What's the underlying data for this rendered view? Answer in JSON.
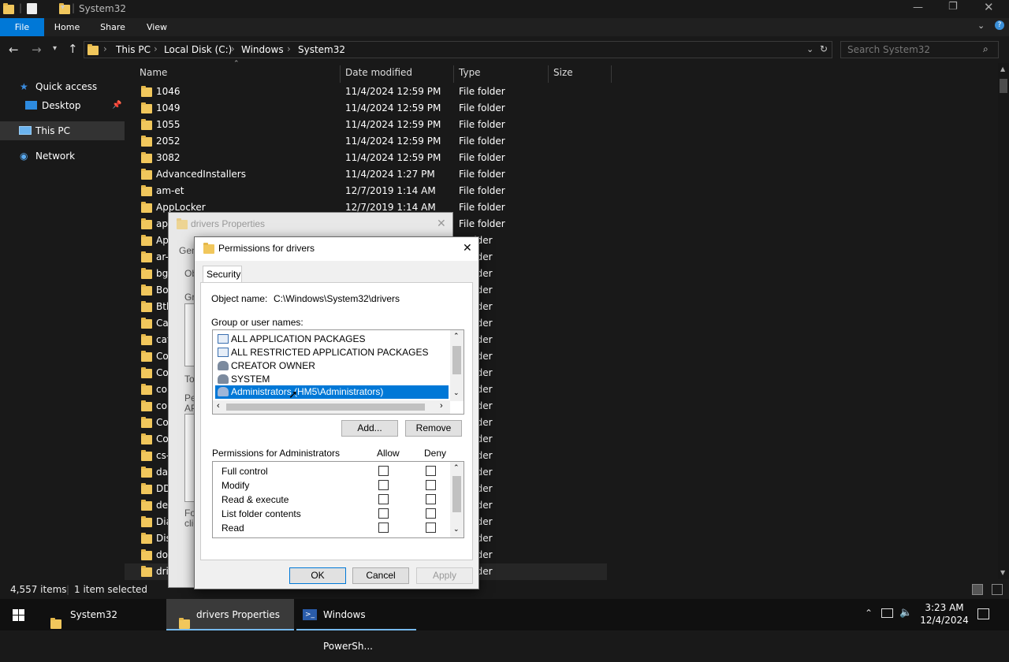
{
  "window": {
    "title": "System32"
  },
  "ribbon": {
    "tabs": [
      "File",
      "Home",
      "Share",
      "View"
    ]
  },
  "address": {
    "crumbs": [
      "This PC",
      "Local Disk (C:)",
      "Windows",
      "System32"
    ],
    "search_placeholder": "Search System32"
  },
  "sidebar": {
    "items": [
      {
        "label": "Quick access",
        "icon": "star-icon"
      },
      {
        "label": "Desktop",
        "icon": "desktop-icon"
      },
      {
        "label": "This PC",
        "icon": "pc-icon"
      },
      {
        "label": "Network",
        "icon": "network-icon"
      }
    ]
  },
  "columns": {
    "name": "Name",
    "date": "Date modified",
    "type": "Type",
    "size": "Size"
  },
  "files": [
    {
      "name": "1046",
      "date": "11/4/2024 12:59 PM",
      "type": "File folder"
    },
    {
      "name": "1049",
      "date": "11/4/2024 12:59 PM",
      "type": "File folder"
    },
    {
      "name": "1055",
      "date": "11/4/2024 12:59 PM",
      "type": "File folder"
    },
    {
      "name": "2052",
      "date": "11/4/2024 12:59 PM",
      "type": "File folder"
    },
    {
      "name": "3082",
      "date": "11/4/2024 12:59 PM",
      "type": "File folder"
    },
    {
      "name": "AdvancedInstallers",
      "date": "11/4/2024 1:27 PM",
      "type": "File folder"
    },
    {
      "name": "am-et",
      "date": "12/7/2019 1:14 AM",
      "type": "File folder"
    },
    {
      "name": "AppLocker",
      "date": "12/7/2019 1:14 AM",
      "type": "File folder"
    },
    {
      "name": "ap",
      "date": "",
      "type": "File folder"
    },
    {
      "name": "Ap",
      "date": "",
      "type": "older"
    },
    {
      "name": "ar-",
      "date": "",
      "type": "older"
    },
    {
      "name": "bg",
      "date": "",
      "type": "older"
    },
    {
      "name": "Bo",
      "date": "",
      "type": "older"
    },
    {
      "name": "Bth",
      "date": "",
      "type": "older"
    },
    {
      "name": "Ca",
      "date": "",
      "type": "older"
    },
    {
      "name": "cat",
      "date": "",
      "type": "older"
    },
    {
      "name": "Co",
      "date": "",
      "type": "older"
    },
    {
      "name": "Co",
      "date": "",
      "type": "older"
    },
    {
      "name": "co",
      "date": "",
      "type": "older"
    },
    {
      "name": "co",
      "date": "",
      "type": "older"
    },
    {
      "name": "Co",
      "date": "",
      "type": "older"
    },
    {
      "name": "Co",
      "date": "",
      "type": "older"
    },
    {
      "name": "cs-",
      "date": "",
      "type": "older"
    },
    {
      "name": "da",
      "date": "",
      "type": "older"
    },
    {
      "name": "DD",
      "date": "",
      "type": "older"
    },
    {
      "name": "de",
      "date": "",
      "type": "older"
    },
    {
      "name": "Dia",
      "date": "",
      "type": "older"
    },
    {
      "name": "Dis",
      "date": "",
      "type": "older"
    },
    {
      "name": "do",
      "date": "",
      "type": "older"
    },
    {
      "name": "dri",
      "date": "",
      "type": "older"
    }
  ],
  "status": {
    "count": "4,557 items",
    "selected": "1 item selected"
  },
  "taskbar": {
    "items": [
      "System32",
      "drivers Properties",
      "Windows PowerSh..."
    ],
    "time": "3:23 AM",
    "date": "12/4/2024"
  },
  "props_dialog": {
    "title": "drivers Properties",
    "tab_partial": "Gen",
    "frag_obj": "Ob",
    "frag_gr": "Gr",
    "frag_to": "To",
    "frag_pe": "Pe",
    "frag_ap": "AP",
    "frag_fo": "Fo",
    "frag_cli": "clic"
  },
  "perm_dialog": {
    "title": "Permissions for drivers",
    "tab": "Security",
    "object_label": "Object name:",
    "object_value": "C:\\Windows\\System32\\drivers",
    "group_label": "Group or user names:",
    "groups": [
      {
        "label": "ALL APPLICATION PACKAGES",
        "icon": "package-group-icon"
      },
      {
        "label": "ALL RESTRICTED APPLICATION PACKAGES",
        "icon": "package-group-icon"
      },
      {
        "label": "CREATOR OWNER",
        "icon": "user-group-icon"
      },
      {
        "label": "SYSTEM",
        "icon": "user-group-icon"
      },
      {
        "label": "Administrators (HM5\\Administrators)",
        "icon": "user-group-icon",
        "selected": true
      }
    ],
    "add_button": "Add...",
    "remove_button": "Remove",
    "perm_label": "Permissions for Administrators",
    "allow_label": "Allow",
    "deny_label": "Deny",
    "permissions": [
      "Full control",
      "Modify",
      "Read & execute",
      "List folder contents",
      "Read"
    ],
    "ok": "OK",
    "cancel": "Cancel",
    "apply": "Apply"
  },
  "colors": {
    "accent": "#0078d7",
    "selection": "#0078d7",
    "folder": "#f1c75c"
  }
}
